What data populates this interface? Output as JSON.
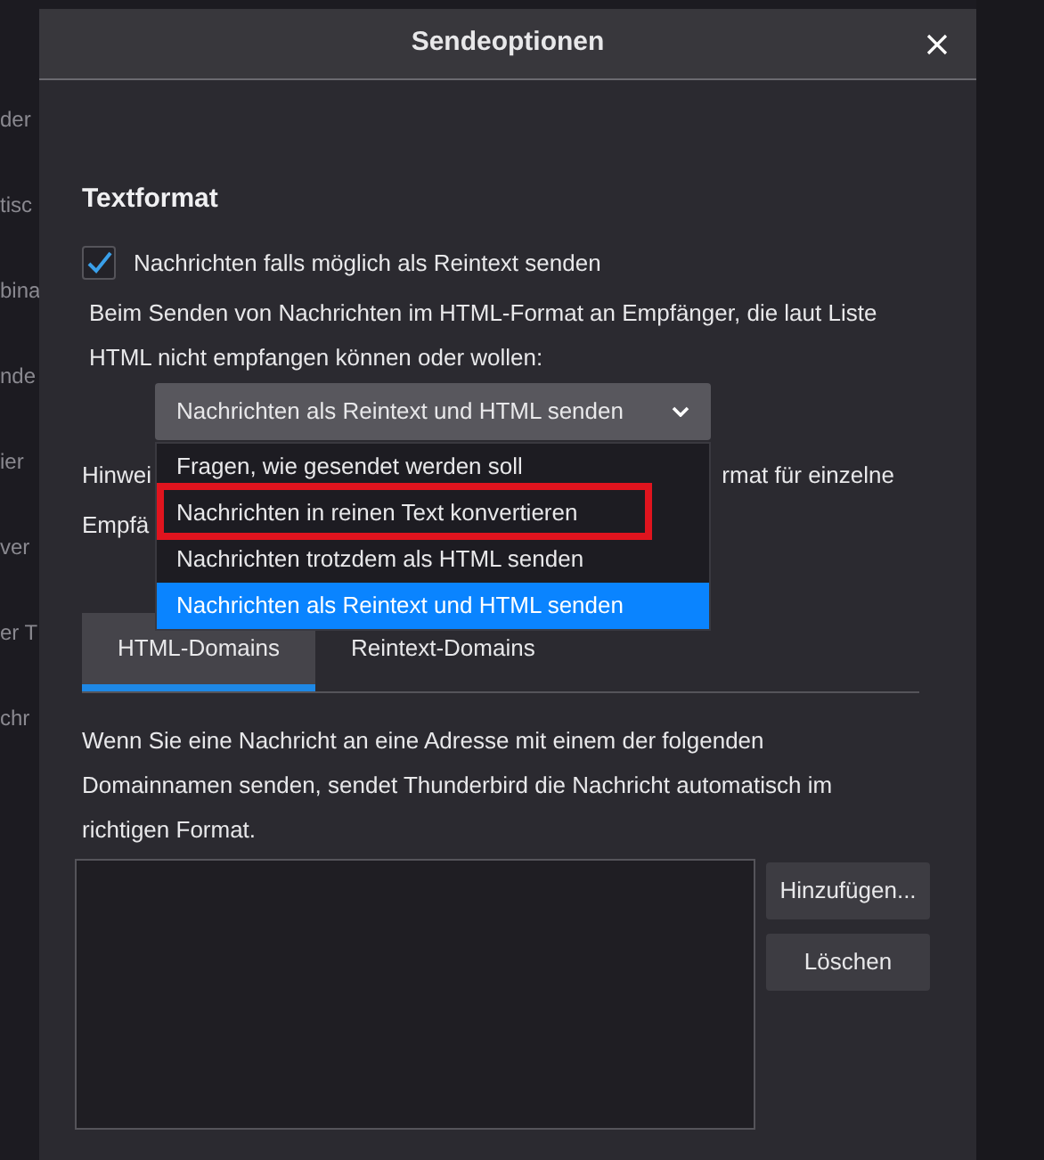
{
  "background_fragments": [
    "der",
    "tisc",
    "bina",
    "nde",
    "ier",
    "ver",
    "er T",
    "chr"
  ],
  "dialog": {
    "title": "Sendeoptionen"
  },
  "section_title": "Textformat",
  "plaintext_checkbox": {
    "label": "Nachrichten falls möglich als Reintext senden",
    "checked": true
  },
  "description": "Beim Senden von Nachrichten im HTML-Format an Empfänger, die laut Liste HTML nicht empfangen können oder wollen:",
  "select": {
    "value": "Nachrichten als Reintext und HTML senden",
    "expanded": true,
    "options": [
      {
        "label": "Fragen, wie gesendet werden soll",
        "selected": false,
        "highlighted": false
      },
      {
        "label": "Nachrichten in reinen Text konvertieren",
        "selected": false,
        "highlighted": true
      },
      {
        "label": "Nachrichten trotzdem als HTML senden",
        "selected": false,
        "highlighted": false
      },
      {
        "label": "Nachrichten als Reintext und HTML senden",
        "selected": true,
        "highlighted": false
      }
    ]
  },
  "hint": {
    "line_1_start": "Hinwei",
    "line_1_end": "rmat für einzelne",
    "line_2_start": "Empfä"
  },
  "tabs": [
    {
      "label": "HTML-Domains",
      "selected": true
    },
    {
      "label": "Reintext-Domains",
      "selected": false
    }
  ],
  "domains_text": "Wenn Sie eine Nachricht an eine Adresse mit einem der folgenden Domainnamen senden, sendet Thunderbird die Nachricht automatisch im richtigen Format.",
  "buttons": [
    "Hinzufügen...",
    "Löschen"
  ]
}
